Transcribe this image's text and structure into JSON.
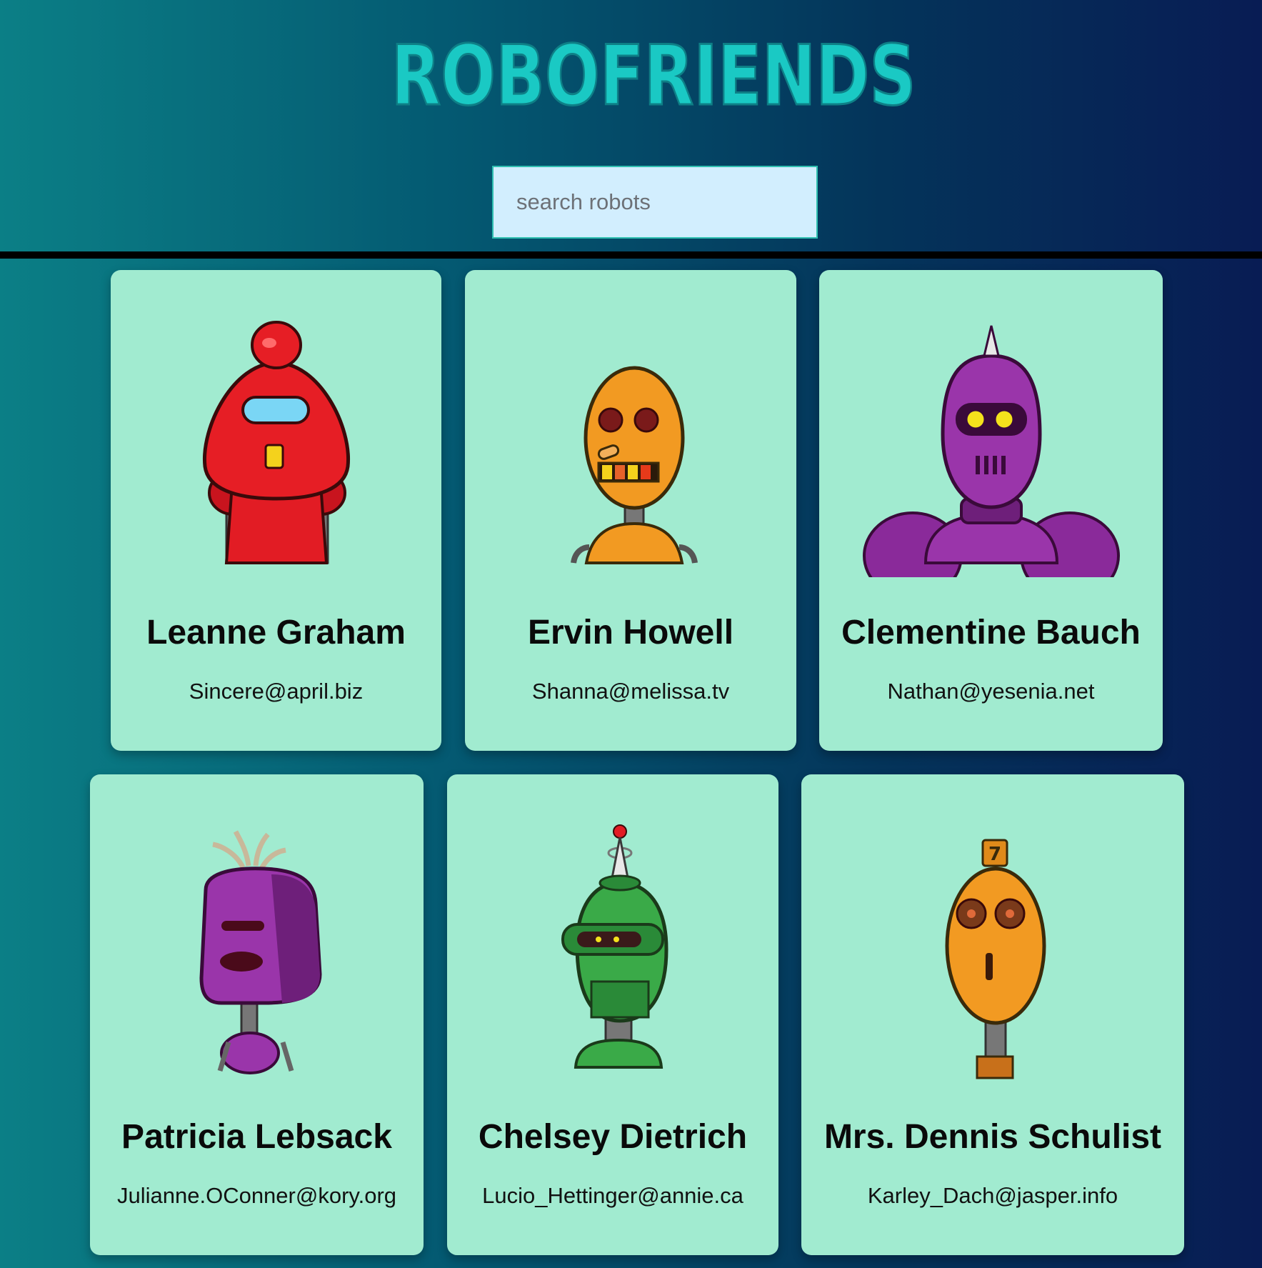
{
  "app": {
    "title": "ROBOFRIENDS"
  },
  "search": {
    "placeholder": "search robots",
    "value": ""
  },
  "colors": {
    "card_background": "#a1ebd0",
    "logo": "#1ac9c4",
    "search_background": "#d2eefe"
  },
  "robots": [
    {
      "name": "Leanne Graham",
      "email": "Sincere@april.biz",
      "avatar_icon": "red-robot-icon"
    },
    {
      "name": "Ervin Howell",
      "email": "Shanna@melissa.tv",
      "avatar_icon": "orange-robot-icon"
    },
    {
      "name": "Clementine Bauch",
      "email": "Nathan@yesenia.net",
      "avatar_icon": "purple-robot-icon"
    },
    {
      "name": "Patricia Lebsack",
      "email": "Julianne.OConner@kory.org",
      "avatar_icon": "purple-robot-icon"
    },
    {
      "name": "Chelsey Dietrich",
      "email": "Lucio_Hettinger@annie.ca",
      "avatar_icon": "green-robot-icon"
    },
    {
      "name": "Mrs. Dennis Schulist",
      "email": "Karley_Dach@jasper.info",
      "avatar_icon": "orange-robot-icon"
    }
  ]
}
